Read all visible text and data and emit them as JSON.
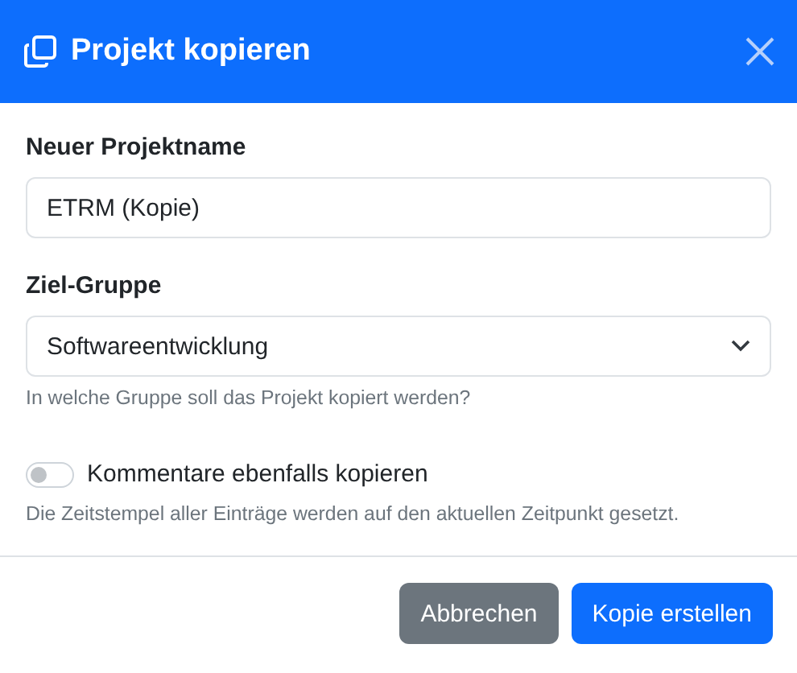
{
  "dialog": {
    "title": "Projekt kopieren"
  },
  "fields": [
    {
      "kind": "text",
      "label": "Neuer Projektname",
      "value": "ETRM (Kopie)"
    },
    {
      "kind": "select",
      "label": "Ziel-Gruppe",
      "value": "Softwareentwicklung",
      "help": "In welche Gruppe soll das Projekt kopiert werden?"
    }
  ],
  "option": {
    "label": "Kommentare ebenfalls kopieren",
    "on": false,
    "help": "Die Zeitstempel aller Einträge werden auf den aktuellen Zeitpunkt gesetzt."
  },
  "buttons": [
    {
      "label": "Abbrechen",
      "kind": "secondary"
    },
    {
      "label": "Kopie erstellen",
      "kind": "primary"
    }
  ]
}
